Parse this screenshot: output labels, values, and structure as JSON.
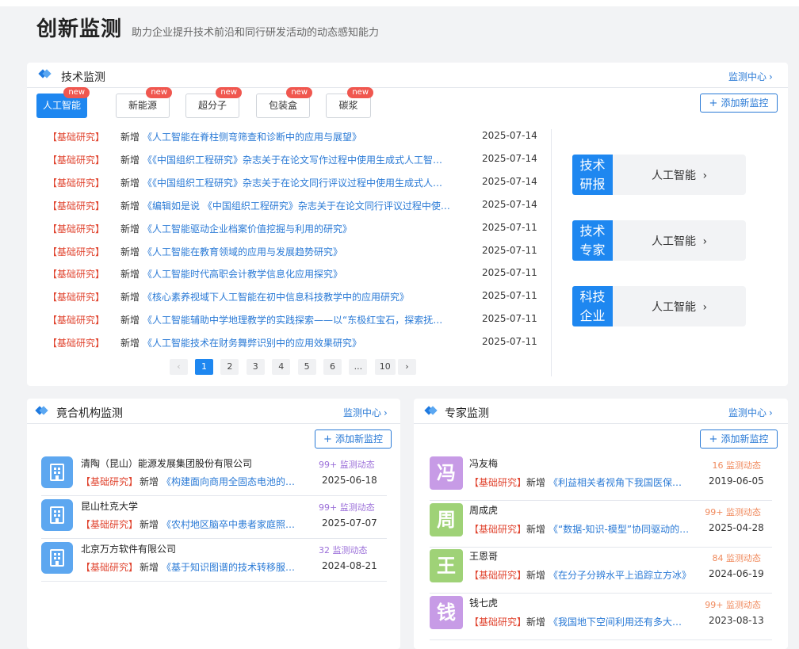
{
  "header": {
    "title": "创新监测",
    "subtitle": "助力企业提升技术前沿和同行研发活动的动态感知能力"
  },
  "tech": {
    "title": "技术监测",
    "center_link": "监测中心",
    "add_label": "添加新监控",
    "tabs": [
      {
        "label": "人工智能",
        "badge": "new",
        "active": true
      },
      {
        "label": "新能源",
        "badge": "new",
        "active": false
      },
      {
        "label": "超分子",
        "badge": "new",
        "active": false
      },
      {
        "label": "包装盒",
        "badge": "new",
        "active": false
      },
      {
        "label": "碳浆",
        "badge": "new",
        "active": false
      }
    ],
    "rows": [
      {
        "tag": "【基础研究】",
        "verb": "新增",
        "title": "《人工智能在脊柱侧弯筛查和诊断中的应用与展望》",
        "date": "2025-07-14"
      },
      {
        "tag": "【基础研究】",
        "verb": "新增",
        "title": "《《中国组织工程研究》杂志关于在论文写作过程中使用生成式人工智能技术的说明》",
        "date": "2025-07-14"
      },
      {
        "tag": "【基础研究】",
        "verb": "新增",
        "title": "《《中国组织工程研究》杂志关于在论文同行评议过程中使用生成式人工智能技术的说明》",
        "date": "2025-07-14"
      },
      {
        "tag": "【基础研究】",
        "verb": "新增",
        "title": "《编辑如是说 《中国组织工程研究》杂志关于在论文同行评议过程中使用生成式人工智能》",
        "date": "2025-07-14"
      },
      {
        "tag": "【基础研究】",
        "verb": "新增",
        "title": "《人工智能驱动企业档案价值挖掘与利用的研究》",
        "date": "2025-07-11"
      },
      {
        "tag": "【基础研究】",
        "verb": "新增",
        "title": "《人工智能在教育领域的应用与发展趋势研究》",
        "date": "2025-07-11"
      },
      {
        "tag": "【基础研究】",
        "verb": "新增",
        "title": "《人工智能时代高职会计教学信息化应用探究》",
        "date": "2025-07-11"
      },
      {
        "tag": "【基础研究】",
        "verb": "新增",
        "title": "《核心素养视域下人工智能在初中信息科技教学中的应用研究》",
        "date": "2025-07-11"
      },
      {
        "tag": "【基础研究】",
        "verb": "新增",
        "title": "《人工智能辅助中学地理教学的实践探索——以“东极红宝石，探索抚远暮色”为例》",
        "date": "2025-07-11"
      },
      {
        "tag": "【基础研究】",
        "verb": "新增",
        "title": "《人工智能技术在财务舞弊识别中的应用效果研究》",
        "date": "2025-07-11"
      }
    ],
    "pagination": {
      "prev": "‹",
      "pages": [
        "1",
        "2",
        "3",
        "4",
        "5",
        "6",
        "...",
        "10"
      ],
      "current": "1",
      "next": "›"
    },
    "side_cards": [
      {
        "block": "技术研报",
        "label": "人工智能"
      },
      {
        "block": "技术专家",
        "label": "人工智能"
      },
      {
        "block": "科技企业",
        "label": "人工智能"
      }
    ]
  },
  "org": {
    "title": "竟合机构监测",
    "center_link": "监测中心",
    "add_label": "添加新监控",
    "rows": [
      {
        "name": "清陶（昆山）能源发展集团股份有限公司",
        "count": "99+ 监测动态",
        "tag": "【基础研究】",
        "verb": "新增",
        "title": "《构建面向商用全固态电池的复合电解质》",
        "date": "2025-06-18"
      },
      {
        "name": "昆山杜克大学",
        "count": "99+ 监测动态",
        "tag": "【基础研究】",
        "verb": "新增",
        "title": "《农村地区脑卒中患者家庭照料者的需求》",
        "date": "2025-07-07"
      },
      {
        "name": "北京万方软件有限公司",
        "count": "32 监测动态",
        "tag": "【基础研究】",
        "verb": "新增",
        "title": "《基于知识图谱的技术转移服务平台》",
        "date": "2024-08-21"
      }
    ]
  },
  "expert": {
    "title": "专家监测",
    "center_link": "监测中心",
    "add_label": "添加新监控",
    "rows": [
      {
        "avatar": "冯",
        "color": "#c79be6",
        "name": "冯友梅",
        "count": "16 监测动态",
        "tag": "【基础研究】",
        "verb": "新增",
        "title": "《利益相关者视角下我国医保支付方式》",
        "date": "2019-06-05"
      },
      {
        "avatar": "周",
        "color": "#9fd277",
        "name": "周成虎",
        "count": "99+ 监测动态",
        "tag": "【基础研究】",
        "verb": "新增",
        "title": "《“数据-知识-模型”协同驱动的智能》",
        "date": "2025-04-28"
      },
      {
        "avatar": "王",
        "color": "#9fd277",
        "name": "王恩哥",
        "count": "84 监测动态",
        "tag": "【基础研究】",
        "verb": "新增",
        "title": "《在分子分辨水平上追踪立方冰》",
        "date": "2024-06-19"
      },
      {
        "avatar": "钱",
        "color": "#c79be6",
        "name": "钱七虎",
        "count": "99+ 监测动态",
        "tag": "【基础研究】",
        "verb": "新增",
        "title": "《我国地下空间利用还有多大空间》",
        "date": "2023-08-13"
      }
    ]
  }
}
